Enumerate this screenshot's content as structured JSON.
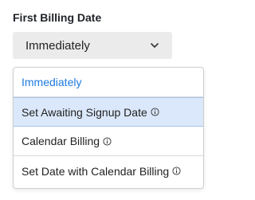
{
  "field": {
    "label": "First Billing Date",
    "selected_value": "Immediately"
  },
  "options": [
    {
      "label": "Immediately",
      "state": "selected",
      "has_info_icon": false
    },
    {
      "label": "Set Awaiting Signup Date",
      "state": "hover",
      "has_info_icon": true
    },
    {
      "label": "Calendar Billing",
      "state": "normal",
      "has_info_icon": true
    },
    {
      "label": "Set Date with Calendar Billing",
      "state": "normal",
      "has_info_icon": true
    }
  ],
  "colors": {
    "selected_text": "#1d7be0",
    "hover_background": "#dbe8fb",
    "trigger_background": "#ebebeb"
  },
  "icons": {
    "trigger": "chevron-down-icon",
    "option_info": "info-icon"
  }
}
